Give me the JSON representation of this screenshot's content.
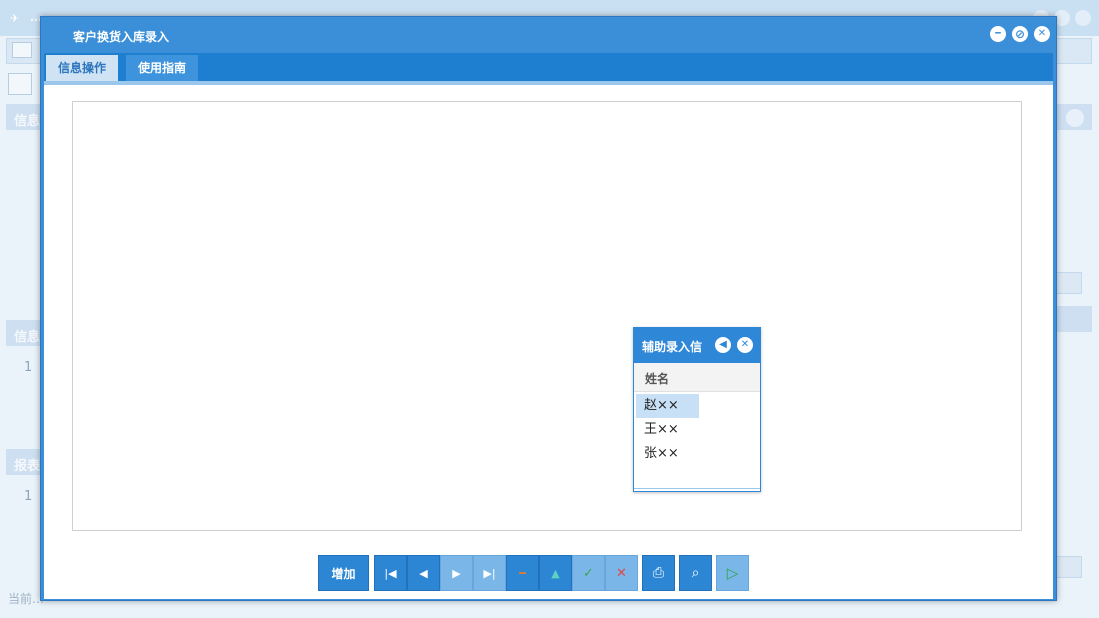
{
  "background": {
    "app_title": "…",
    "panels": [
      {
        "title": "信息"
      },
      {
        "title": "信息"
      },
      {
        "title": "报表"
      }
    ],
    "row_numbers": [
      "1",
      "1"
    ],
    "status_text": "当前…"
  },
  "dialog": {
    "title": "客户换货入库录入",
    "tabs": [
      {
        "label": "信息操作"
      },
      {
        "label": "使用指南"
      }
    ]
  },
  "toolbar": {
    "add_label": "增加",
    "buttons": [
      {
        "name": "first-record",
        "icon": "⏮"
      },
      {
        "name": "prev-record",
        "icon": "◀"
      },
      {
        "name": "next-record",
        "icon": "▶"
      },
      {
        "name": "last-record",
        "icon": "⏭"
      },
      {
        "name": "delete",
        "icon": "━"
      },
      {
        "name": "edit",
        "icon": "▲"
      },
      {
        "name": "confirm",
        "icon": "✓"
      },
      {
        "name": "cancel",
        "icon": "✕"
      },
      {
        "name": "print",
        "icon": "🖶"
      },
      {
        "name": "preview",
        "icon": "🔍"
      },
      {
        "name": "run",
        "icon": "▷"
      }
    ]
  },
  "aux_popup": {
    "title": "辅助录入信",
    "column_header": "姓名",
    "rows": [
      "赵××",
      "王××",
      "张××"
    ]
  },
  "colors": {
    "accent": "#3a8fd8",
    "tab_active_bg": "#cfe3f5",
    "selected_row": "#c7e0f6"
  }
}
